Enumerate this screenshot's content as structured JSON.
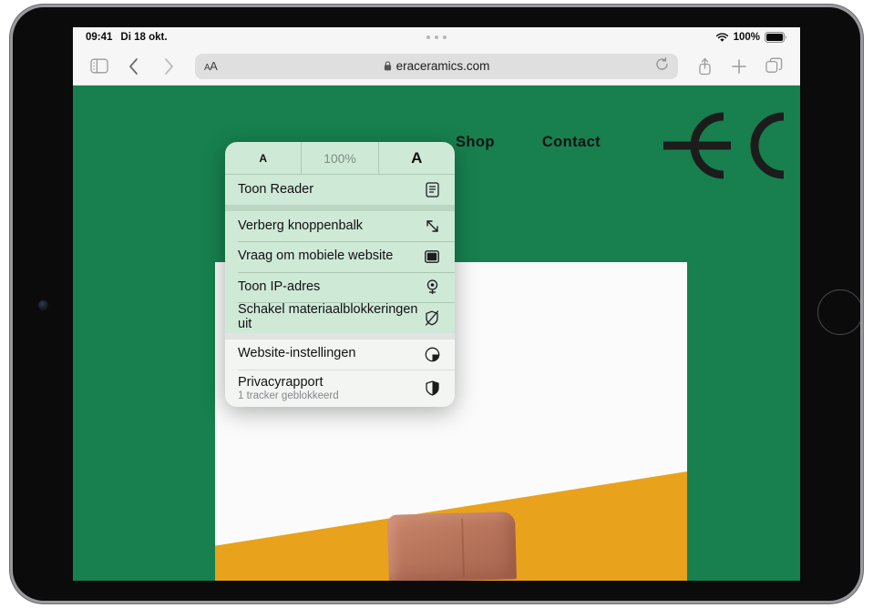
{
  "status_bar": {
    "time": "09:41",
    "date": "Di 18 okt.",
    "wifi_icon": "wifi-icon",
    "battery_percent": "100%",
    "battery_icon": "battery-icon",
    "multitask_handle": "multitask-handle-dots"
  },
  "toolbar": {
    "sidebar_icon": "sidebar-icon",
    "back_icon": "chevron-left-icon",
    "forward_icon": "chevron-right-icon",
    "text_size_label_small": "A",
    "text_size_label_large": "A",
    "lock_icon": "lock-icon",
    "url": "eraceramics.com",
    "reload_icon": "reload-icon",
    "share_icon": "share-icon",
    "new_tab_icon": "plus-icon",
    "tabs_icon": "tabs-icon"
  },
  "aa_menu": {
    "zoom": {
      "smaller_label": "A",
      "level": "100%",
      "larger_label": "A"
    },
    "groups": [
      {
        "style": "tinted",
        "items": [
          {
            "label": "Toon Reader",
            "icon": "reader-icon"
          }
        ]
      },
      {
        "style": "tinted",
        "items": [
          {
            "label": "Verberg knoppenbalk",
            "icon": "hide-toolbar-arrows-icon"
          },
          {
            "label": "Vraag om mobiele website",
            "icon": "desktop-window-icon"
          },
          {
            "label": "Toon IP-adres",
            "icon": "location-pin-icon"
          },
          {
            "label": "Schakel materiaalblokkeringen uit",
            "icon": "shield-slash-icon"
          }
        ]
      },
      {
        "style": "light",
        "items": [
          {
            "label": "Website-instellingen",
            "icon": "website-settings-icon"
          },
          {
            "label": "Privacyrapport",
            "sublabel": "1 tracker geblokkeerd",
            "icon": "privacy-shield-icon"
          }
        ]
      }
    ]
  },
  "web_page": {
    "nav_links": [
      "Shop",
      "Contact"
    ],
    "logo": "eraceramics-ec-monogram",
    "hero_image_alt": "clay-block-on-orange-surface",
    "colors": {
      "brand_green": "#17804e",
      "hero_orange": "#e8a21c",
      "clay_terracotta": "#b8755c",
      "card_white": "#fbfbfb",
      "menu_mint": "#cfe9d7"
    }
  }
}
